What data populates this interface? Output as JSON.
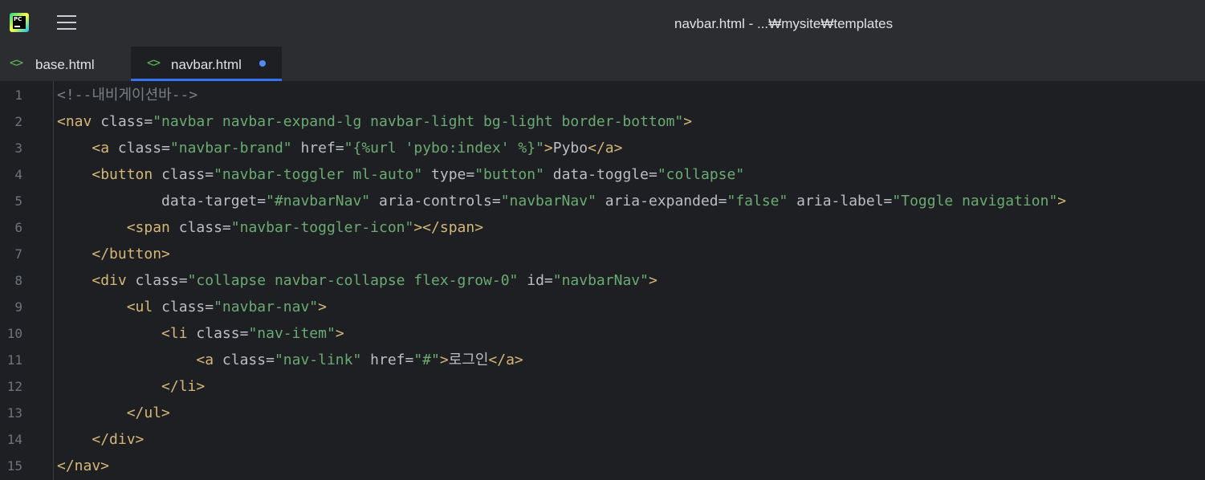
{
  "window": {
    "title": "navbar.html - ...₩mysite₩templates"
  },
  "app": {
    "logo_icon": "pycharm-logo-icon",
    "logo_text": "PC",
    "menu_icon": "hamburger-menu-icon"
  },
  "tabs": [
    {
      "label": "base.html",
      "icon": "html-file-icon",
      "active": false,
      "modified": false
    },
    {
      "label": "navbar.html",
      "icon": "html-file-icon",
      "active": true,
      "modified": true
    }
  ],
  "colors": {
    "tag": "#d5b778",
    "attribute": "#bcbec4",
    "string": "#6aab73",
    "comment": "#7a7e85",
    "accent": "#3574f0",
    "modified_dot": "#548af7"
  },
  "editor": {
    "lines": [
      {
        "number": "1",
        "tokens": [
          {
            "t": "comment",
            "v": "<!--내비게이션바-->"
          }
        ]
      },
      {
        "number": "2",
        "tokens": [
          {
            "t": "tag",
            "v": "<nav "
          },
          {
            "t": "attr",
            "v": "class="
          },
          {
            "t": "value",
            "v": "\"navbar navbar-expand-lg navbar-light bg-light border-bottom\""
          },
          {
            "t": "tag",
            "v": ">"
          }
        ]
      },
      {
        "number": "3",
        "tokens": [
          {
            "t": "text",
            "v": "    "
          },
          {
            "t": "tag",
            "v": "<a "
          },
          {
            "t": "attr",
            "v": "class="
          },
          {
            "t": "value",
            "v": "\"navbar-brand\""
          },
          {
            "t": "attr",
            "v": " href="
          },
          {
            "t": "value",
            "v": "\"{%url 'pybo:index' %}\""
          },
          {
            "t": "tag",
            "v": ">"
          },
          {
            "t": "text",
            "v": "Pybo"
          },
          {
            "t": "tag",
            "v": "</a>"
          }
        ]
      },
      {
        "number": "4",
        "tokens": [
          {
            "t": "text",
            "v": "    "
          },
          {
            "t": "tag",
            "v": "<button "
          },
          {
            "t": "attr",
            "v": "class="
          },
          {
            "t": "value",
            "v": "\"navbar-toggler ml-auto\""
          },
          {
            "t": "attr",
            "v": " type="
          },
          {
            "t": "value",
            "v": "\"button\""
          },
          {
            "t": "attr",
            "v": " data-toggle="
          },
          {
            "t": "value",
            "v": "\"collapse\""
          }
        ]
      },
      {
        "number": "5",
        "tokens": [
          {
            "t": "text",
            "v": "            "
          },
          {
            "t": "attr",
            "v": "data-target="
          },
          {
            "t": "value",
            "v": "\"#navbarNav\""
          },
          {
            "t": "attr",
            "v": " aria-controls="
          },
          {
            "t": "value",
            "v": "\"navbarNav\""
          },
          {
            "t": "attr",
            "v": " aria-expanded="
          },
          {
            "t": "value",
            "v": "\"false\""
          },
          {
            "t": "attr",
            "v": " aria-label="
          },
          {
            "t": "value",
            "v": "\"Toggle navigation\""
          },
          {
            "t": "tag",
            "v": ">"
          }
        ]
      },
      {
        "number": "6",
        "tokens": [
          {
            "t": "text",
            "v": "        "
          },
          {
            "t": "tag",
            "v": "<span "
          },
          {
            "t": "attr",
            "v": "class="
          },
          {
            "t": "value",
            "v": "\"navbar-toggler-icon\""
          },
          {
            "t": "tag",
            "v": "></span>"
          }
        ]
      },
      {
        "number": "7",
        "tokens": [
          {
            "t": "text",
            "v": "    "
          },
          {
            "t": "tag",
            "v": "</button>"
          }
        ]
      },
      {
        "number": "8",
        "tokens": [
          {
            "t": "text",
            "v": "    "
          },
          {
            "t": "tag",
            "v": "<div "
          },
          {
            "t": "attr",
            "v": "class="
          },
          {
            "t": "value",
            "v": "\"collapse navbar-collapse flex-grow-0\""
          },
          {
            "t": "attr",
            "v": " id="
          },
          {
            "t": "value",
            "v": "\"navbarNav\""
          },
          {
            "t": "tag",
            "v": ">"
          }
        ]
      },
      {
        "number": "9",
        "tokens": [
          {
            "t": "text",
            "v": "        "
          },
          {
            "t": "tag",
            "v": "<ul "
          },
          {
            "t": "attr",
            "v": "class="
          },
          {
            "t": "value",
            "v": "\"navbar-nav\""
          },
          {
            "t": "tag",
            "v": ">"
          }
        ]
      },
      {
        "number": "10",
        "tokens": [
          {
            "t": "text",
            "v": "            "
          },
          {
            "t": "tag",
            "v": "<li "
          },
          {
            "t": "attr",
            "v": "class="
          },
          {
            "t": "value",
            "v": "\"nav-item\""
          },
          {
            "t": "tag",
            "v": ">"
          }
        ]
      },
      {
        "number": "11",
        "tokens": [
          {
            "t": "text",
            "v": "                "
          },
          {
            "t": "tag",
            "v": "<a "
          },
          {
            "t": "attr",
            "v": "class="
          },
          {
            "t": "value",
            "v": "\"nav-link\""
          },
          {
            "t": "attr",
            "v": " href="
          },
          {
            "t": "value",
            "v": "\"#\""
          },
          {
            "t": "tag",
            "v": ">"
          },
          {
            "t": "text",
            "v": "로그인"
          },
          {
            "t": "tag",
            "v": "</a>"
          }
        ]
      },
      {
        "number": "12",
        "tokens": [
          {
            "t": "text",
            "v": "            "
          },
          {
            "t": "tag",
            "v": "</li>"
          }
        ]
      },
      {
        "number": "13",
        "tokens": [
          {
            "t": "text",
            "v": "        "
          },
          {
            "t": "tag",
            "v": "</ul>"
          }
        ]
      },
      {
        "number": "14",
        "tokens": [
          {
            "t": "text",
            "v": "    "
          },
          {
            "t": "tag",
            "v": "</div>"
          }
        ]
      },
      {
        "number": "15",
        "tokens": [
          {
            "t": "tag",
            "v": "</nav>"
          }
        ]
      }
    ]
  }
}
